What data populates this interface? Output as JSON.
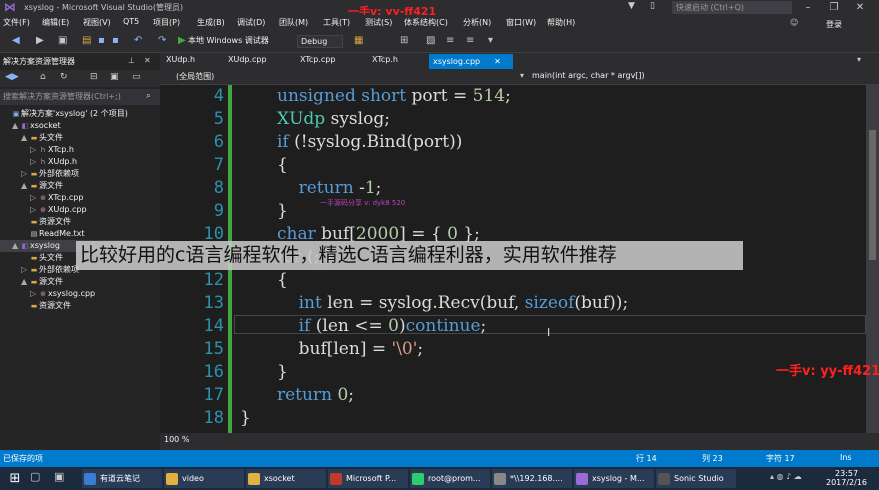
{
  "window": {
    "title": "xsyslog - Microsoft Visual Studio(管理员)",
    "quick_launch": "快速启动 (Ctrl+Q)",
    "login": "登录"
  },
  "menu": [
    "文件(F)",
    "编辑(E)",
    "视图(V)",
    "QT5",
    "项目(P)",
    "生成(B)",
    "调试(D)",
    "团队(M)",
    "工具(T)",
    "测试(S)",
    "体系结构(C)",
    "分析(N)",
    "窗口(W)",
    "帮助(H)"
  ],
  "toolbar": {
    "run_label": "本地 Windows 调试器",
    "config": "Debug"
  },
  "solution_explorer": {
    "title": "解决方案资源管理器",
    "search_placeholder": "搜索解决方案资源管理器(Ctrl+;)",
    "nodes": [
      {
        "label": "解决方案'xsyslog' (2 个项目)",
        "indent": 0,
        "arrow": "",
        "icon": "sln"
      },
      {
        "label": "xsocket",
        "indent": 1,
        "arrow": "▲",
        "icon": "proj"
      },
      {
        "label": "头文件",
        "indent": 2,
        "arrow": "▲",
        "icon": "folder"
      },
      {
        "label": "XTcp.h",
        "indent": 3,
        "arrow": "▷",
        "icon": "h"
      },
      {
        "label": "XUdp.h",
        "indent": 3,
        "arrow": "▷",
        "icon": "h"
      },
      {
        "label": "外部依赖项",
        "indent": 2,
        "arrow": "▷",
        "icon": "folder"
      },
      {
        "label": "源文件",
        "indent": 2,
        "arrow": "▲",
        "icon": "folder"
      },
      {
        "label": "XTcp.cpp",
        "indent": 3,
        "arrow": "▷",
        "icon": "cpp"
      },
      {
        "label": "XUdp.cpp",
        "indent": 3,
        "arrow": "▷",
        "icon": "cpp"
      },
      {
        "label": "资源文件",
        "indent": 2,
        "arrow": "",
        "icon": "folder"
      },
      {
        "label": "ReadMe.txt",
        "indent": 2,
        "arrow": "",
        "icon": "txt"
      },
      {
        "label": "xsyslog",
        "indent": 1,
        "arrow": "▲",
        "icon": "proj",
        "selected": true
      },
      {
        "label": "头文件",
        "indent": 2,
        "arrow": "",
        "icon": "folder"
      },
      {
        "label": "外部依赖项",
        "indent": 2,
        "arrow": "▷",
        "icon": "folder"
      },
      {
        "label": "源文件",
        "indent": 2,
        "arrow": "▲",
        "icon": "folder"
      },
      {
        "label": "xsyslog.cpp",
        "indent": 3,
        "arrow": "▷",
        "icon": "cpp"
      },
      {
        "label": "资源文件",
        "indent": 2,
        "arrow": "",
        "icon": "folder"
      }
    ]
  },
  "tabs": [
    "XUdp.h",
    "XUdp.cpp",
    "XTcp.cpp",
    "XTcp.h"
  ],
  "active_tab": "xsyslog.cpp",
  "nav": {
    "scope": "(全局范围)",
    "member": "main(int argc, char * argv[])"
  },
  "code_lines": [
    {
      "n": "4",
      "html": "<span class='kw'>unsigned short</span> port = <span class='nm'>514</span>;"
    },
    {
      "n": "5",
      "html": "<span class='ty'>XUdp</span> syslog;"
    },
    {
      "n": "6",
      "html": "<span class='kw'>if</span> (!syslog.Bind(port))"
    },
    {
      "n": "7",
      "html": "{"
    },
    {
      "n": "8",
      "html": "    <span class='kw'>return</span> -<span class='nm'>1</span>;"
    },
    {
      "n": "9",
      "html": "}"
    },
    {
      "n": "10",
      "html": "<span class='kw'>char</span> buf[<span class='nm'>2000</span>] = { <span class='nm'>0</span> };"
    },
    {
      "n": "11",
      "html": "<span class='kw'>for</span> (;;)"
    },
    {
      "n": "12",
      "html": "{"
    },
    {
      "n": "13",
      "html": "    <span class='kw'>int</span> len = syslog.Recv(buf, <span class='kw'>sizeof</span>(buf));"
    },
    {
      "n": "14",
      "html": "    <span class='kw'>if</span> (len &lt;= <span class='nm'>0</span>)<span class='kw'>continue</span>;"
    },
    {
      "n": "15",
      "html": "    buf[len] = <span class='st'>'\\0'</span>;"
    },
    {
      "n": "16",
      "html": "}"
    },
    {
      "n": "17",
      "html": "<span class='kw'>return</span> <span class='nm'>0</span>;"
    },
    {
      "n": "18",
      "html": "}"
    }
  ],
  "zoom": "100 %",
  "status": {
    "message": "已保存的项",
    "line": "行 14",
    "col": "列 23",
    "char": "字符 17",
    "mode": "Ins"
  },
  "taskbar": {
    "items": [
      "有道云笔记",
      "video",
      "xsocket",
      "Microsoft P...",
      "root@prom...",
      "*\\\\192.168....",
      "xsyslog - M...",
      "Sonic Studio"
    ],
    "time": "23:57",
    "date": "2017/2/16"
  },
  "overlay_text": "比较好用的c语言编程软件，精选C语言编程利器，实用软件推荐",
  "watermarks": {
    "top": "一手v: yy-ff421",
    "right": "一手v: yy-ff421",
    "code": "一手源码分享 v: dyk8 520"
  },
  "colors": {
    "accent": "#007acc",
    "editor_bg": "#1e1e1e",
    "keyword": "#569cd6",
    "type": "#4ec9b0",
    "number": "#b5cea8",
    "change_bar": "#3ea93e",
    "watermark": "#ff2020"
  }
}
